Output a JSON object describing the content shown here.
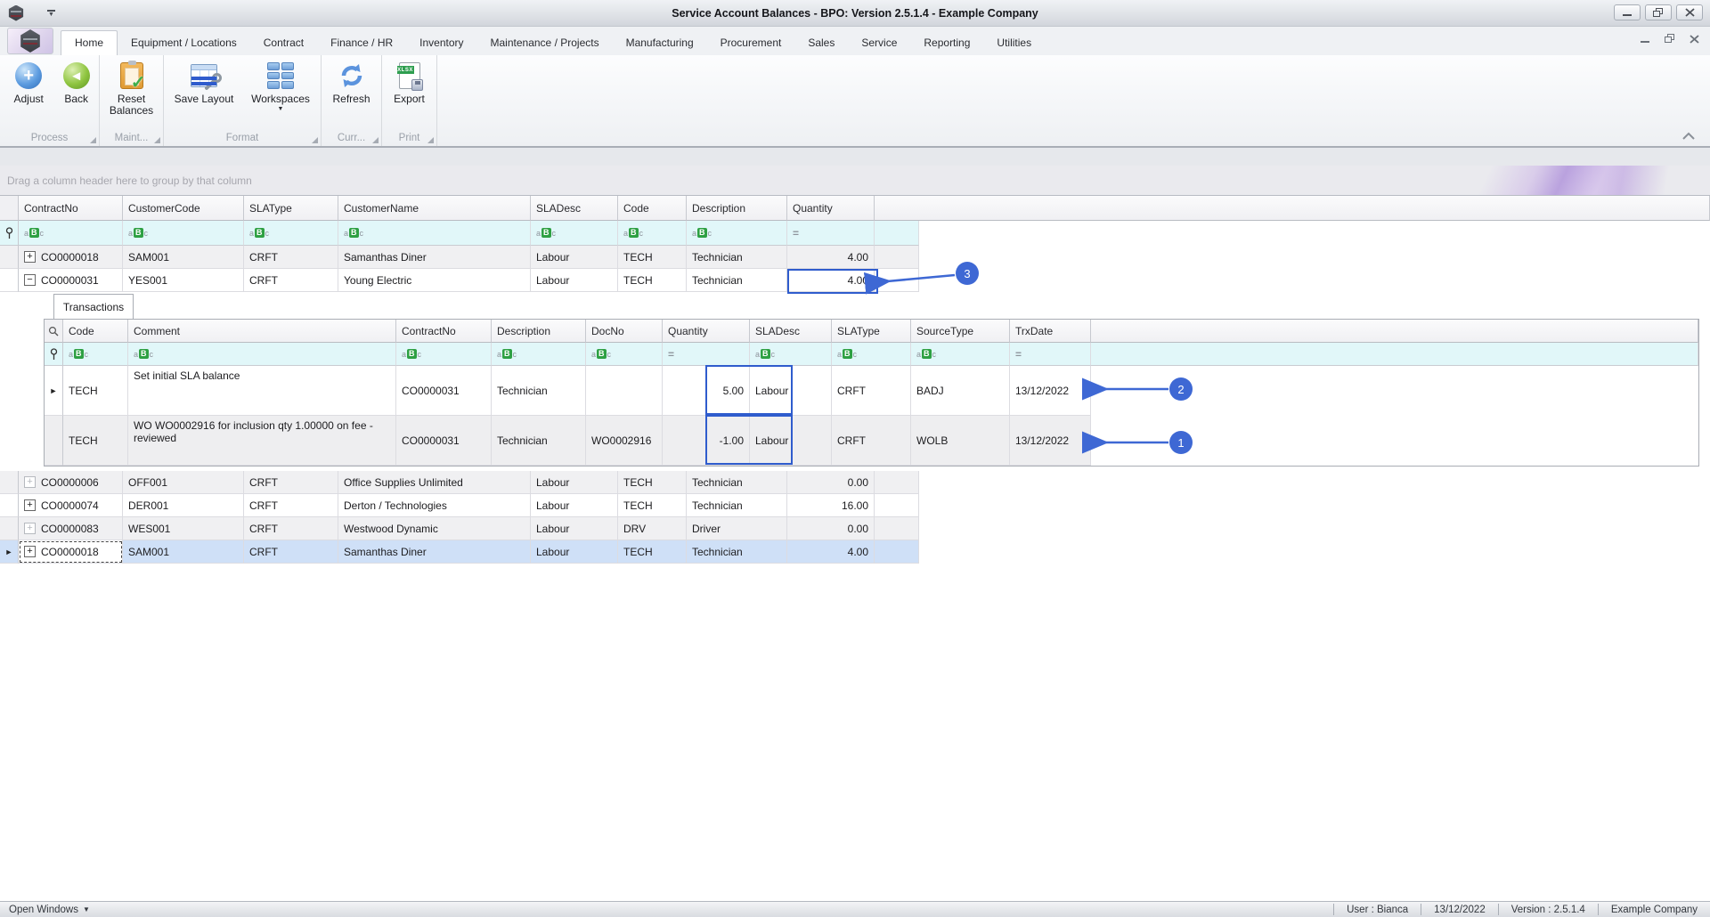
{
  "window": {
    "title": "Service Account Balances - BPO: Version 2.5.1.4 - Example Company"
  },
  "tabs": [
    "Home",
    "Equipment / Locations",
    "Contract",
    "Finance / HR",
    "Inventory",
    "Maintenance / Projects",
    "Manufacturing",
    "Procurement",
    "Sales",
    "Service",
    "Reporting",
    "Utilities"
  ],
  "ribbon": {
    "groups": [
      {
        "label": "Process",
        "buttons": [
          {
            "label": "Adjust"
          },
          {
            "label": "Back"
          }
        ]
      },
      {
        "label": "Maint...",
        "buttons": [
          {
            "label": "Reset Balances"
          }
        ]
      },
      {
        "label": "Format",
        "buttons": [
          {
            "label": "Save Layout"
          },
          {
            "label": "Workspaces"
          }
        ]
      },
      {
        "label": "Curr...",
        "buttons": [
          {
            "label": "Refresh"
          }
        ]
      },
      {
        "label": "Print",
        "buttons": [
          {
            "label": "Export"
          }
        ]
      }
    ]
  },
  "grid": {
    "group_panel_text": "Drag a column header here to group by that column",
    "columns": [
      "ContractNo",
      "CustomerCode",
      "SLAType",
      "CustomerName",
      "SLADesc",
      "Code",
      "Description",
      "Quantity"
    ],
    "rows": [
      {
        "cells": [
          "CO0000018",
          "SAM001",
          "CRFT",
          "Samanthas Diner",
          "Labour",
          "TECH",
          "Technician",
          "4.00"
        ]
      },
      {
        "cells": [
          "CO0000031",
          "YES001",
          "CRFT",
          "Young Electric",
          "Labour",
          "TECH",
          "Technician",
          "4.00"
        ]
      },
      {
        "cells": [
          "CO0000006",
          "OFF001",
          "CRFT",
          "Office Supplies Unlimited",
          "Labour",
          "TECH",
          "Technician",
          "0.00"
        ]
      },
      {
        "cells": [
          "CO0000074",
          "DER001",
          "CRFT",
          "Derton / Technologies",
          "Labour",
          "TECH",
          "Technician",
          "16.00"
        ]
      },
      {
        "cells": [
          "CO0000083",
          "WES001",
          "CRFT",
          "Westwood Dynamic",
          "Labour",
          "DRV",
          "Driver",
          "0.00"
        ]
      },
      {
        "cells": [
          "CO0000018",
          "SAM001",
          "CRFT",
          "Samanthas Diner",
          "Labour",
          "TECH",
          "Technician",
          "4.00"
        ]
      }
    ]
  },
  "detail": {
    "tab_label": "Transactions",
    "columns": [
      "Code",
      "Comment",
      "ContractNo",
      "Description",
      "DocNo",
      "Quantity",
      "SLADesc",
      "SLAType",
      "SourceType",
      "TrxDate"
    ],
    "rows": [
      {
        "cells": [
          "TECH",
          "Set initial SLA balance",
          "CO0000031",
          "Technician",
          "",
          "5.00",
          "Labour",
          "CRFT",
          "BADJ",
          "13/12/2022"
        ]
      },
      {
        "cells": [
          "TECH",
          "WO WO0002916 for inclusion qty 1.00000 on fee - reviewed",
          "CO0000031",
          "Technician",
          "WO0002916",
          "-1.00",
          "Labour",
          "CRFT",
          "WOLB",
          "13/12/2022"
        ]
      }
    ]
  },
  "callouts": {
    "one": "1",
    "two": "2",
    "three": "3"
  },
  "status_bar": {
    "open_windows": "Open Windows",
    "user": "User : Bianca",
    "date": "13/12/2022",
    "version": "Version : 2.5.1.4",
    "company": "Example Company"
  },
  "icons": {
    "abc_a": "a",
    "abc_b": "B",
    "abc_c": "c",
    "equals": "=",
    "plus": "+",
    "minus": "−",
    "row_arrow": "►",
    "caret_down": "▼",
    "xlsx": "XLSX"
  },
  "colors": {
    "accent_blue": "#3e68d4",
    "highlight_border": "#2f5ccd",
    "selected_row": "#cfe0f7",
    "filter_row": "#e1f7f9",
    "filter_icon_green": "#2ea043"
  }
}
